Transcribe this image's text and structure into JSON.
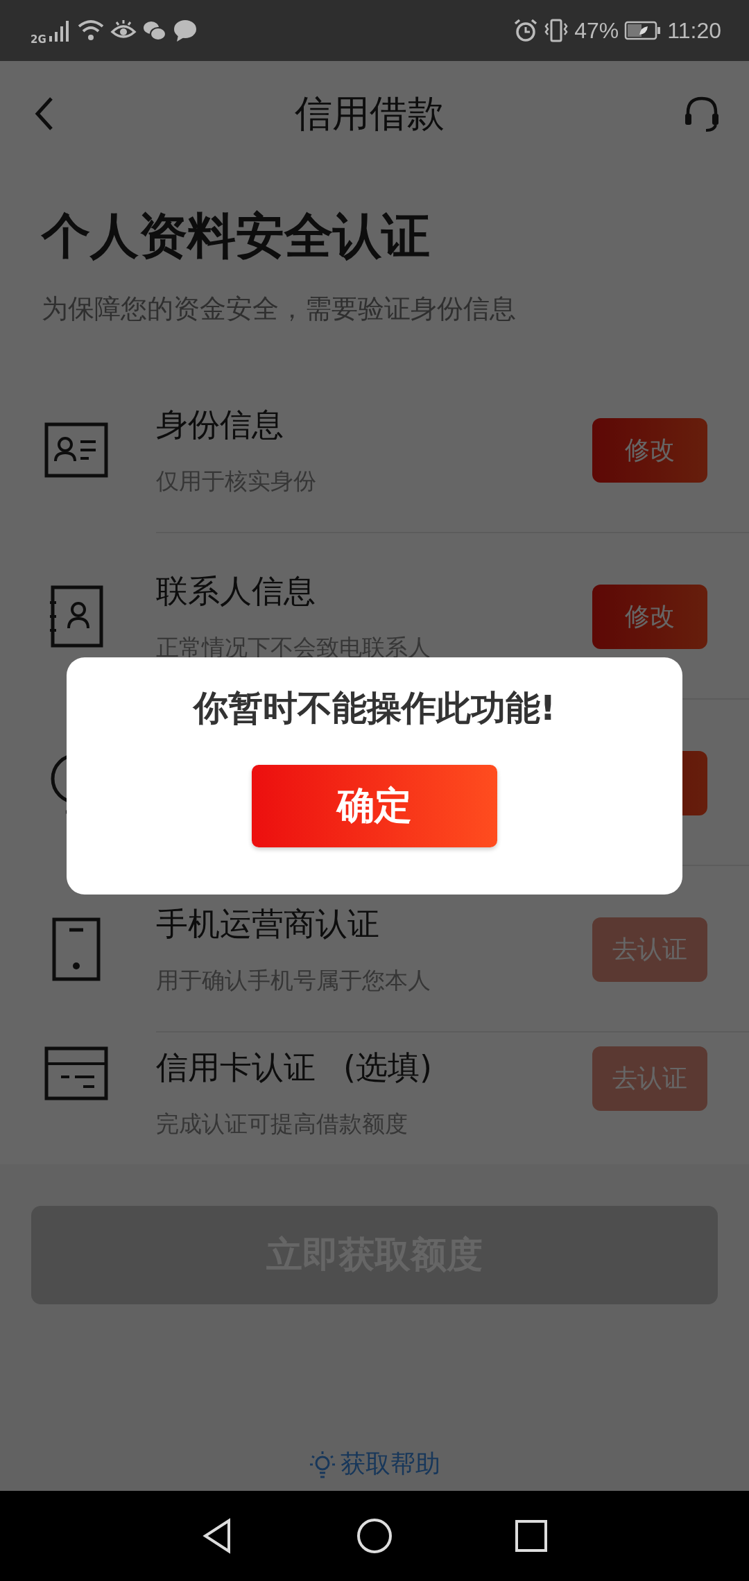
{
  "status_bar": {
    "network": "2G",
    "battery": "47%",
    "time": "11:20"
  },
  "header": {
    "title": "信用借款"
  },
  "heading": "个人资料安全认证",
  "subtitle": "为保障您的资金安全，需要验证身份信息",
  "items": [
    {
      "kind": "id-card",
      "title": "身份信息",
      "note": "仅用于核实身份",
      "button": {
        "label": "修改",
        "disabled": false
      }
    },
    {
      "kind": "contact",
      "title": "联系人信息",
      "note": "正常情况下不会致电联系人",
      "button": {
        "label": "修改",
        "disabled": false
      }
    },
    {
      "kind": "circle",
      "button": {
        "disabled": false
      }
    },
    {
      "kind": "phone",
      "title": "手机运营商认证",
      "note": "用于确认手机号属于您本人",
      "button": {
        "label": "去认证",
        "disabled": true
      }
    },
    {
      "kind": "card",
      "title": "信用卡认证",
      "optional": "(选填)",
      "note": "完成认证可提高借款额度",
      "button": {
        "label": "去认证",
        "disabled": true
      }
    }
  ],
  "primary_button": {
    "label": "立即获取额度",
    "disabled": true
  },
  "help_link": "获取帮助",
  "dialog": {
    "message": "你暂时不能操作此功能!",
    "button": "确定"
  }
}
